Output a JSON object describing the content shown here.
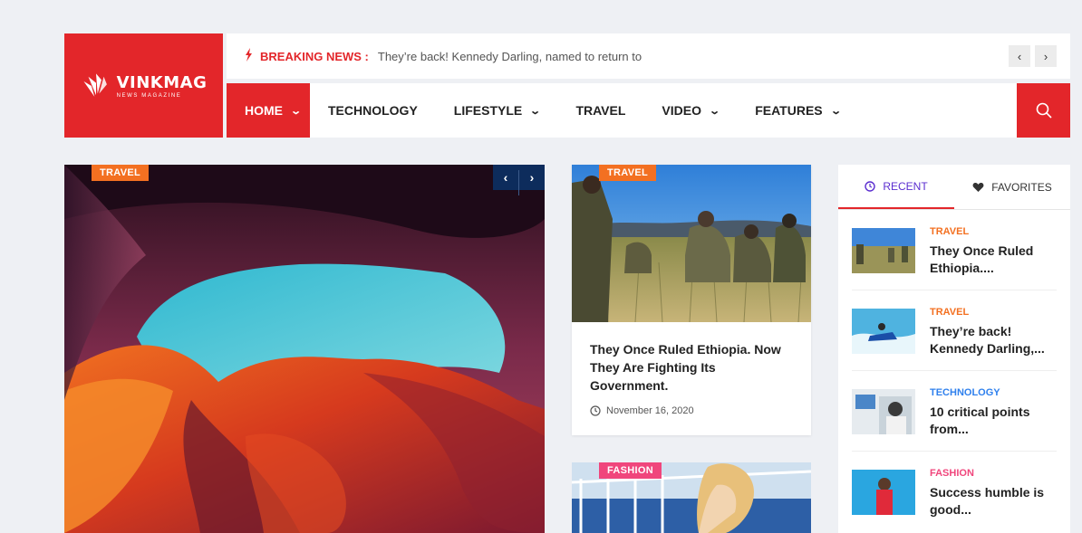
{
  "brand": {
    "name": "VINKMAG",
    "tagline": "NEWS MAGAZINE",
    "color": "#e3262a"
  },
  "breaking": {
    "label": "BREAKING NEWS :",
    "text": "They’re back! Kennedy Darling, named to return to",
    "prev": "‹",
    "next": "›"
  },
  "nav": {
    "items": [
      {
        "label": "HOME",
        "dropdown": true,
        "active": true
      },
      {
        "label": "TECHNOLOGY",
        "dropdown": false
      },
      {
        "label": "LIFESTYLE",
        "dropdown": true
      },
      {
        "label": "TRAVEL",
        "dropdown": false
      },
      {
        "label": "VIDEO",
        "dropdown": true
      },
      {
        "label": "FEATURES",
        "dropdown": true
      }
    ],
    "search_icon": "search-icon"
  },
  "hero": {
    "category": "TRAVEL",
    "category_color": "#f37021",
    "prev": "‹",
    "next": "›"
  },
  "card": {
    "category": "TRAVEL",
    "title": "They Once Ruled Ethiopia. Now They Are Fighting Its Government.",
    "date": "November 16, 2020"
  },
  "card2": {
    "category": "FASHION",
    "category_color": "#f0467c"
  },
  "sidebar": {
    "tabs": [
      {
        "label": "RECENT",
        "icon": "clock-icon",
        "active": true
      },
      {
        "label": "FAVORITES",
        "icon": "heart-icon",
        "active": false
      }
    ],
    "items": [
      {
        "category": "TRAVEL",
        "color": "#f37021",
        "title": "They Once Ruled Ethiopia...."
      },
      {
        "category": "TRAVEL",
        "color": "#f37021",
        "title": "They’re back! Kennedy Darling,..."
      },
      {
        "category": "TECHNOLOGY",
        "color": "#2f80ed",
        "title": "10 critical points from..."
      },
      {
        "category": "FASHION",
        "color": "#f0467c",
        "title": "Success humble is good..."
      }
    ]
  }
}
